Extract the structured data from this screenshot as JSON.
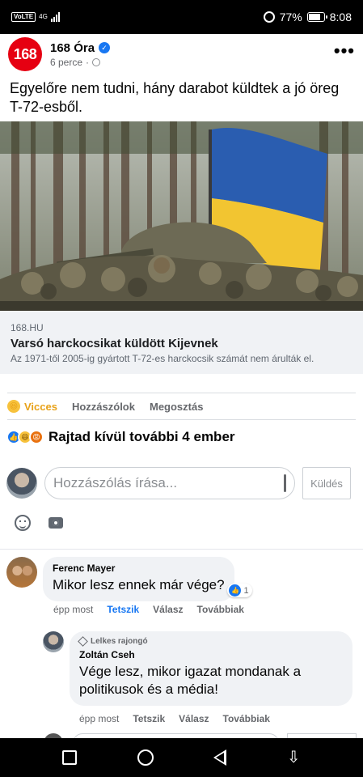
{
  "status_bar": {
    "volte": "VoLTE",
    "network": "4G",
    "battery_percent": "77%",
    "battery_level": 0.77,
    "time": "8:08"
  },
  "post": {
    "page_avatar_text": "168",
    "page_name": "168 Óra",
    "time": "6 perce",
    "separator": "·",
    "text": "Egyelőre nem tudni, hány darabot küldtek a jó öreg T-72-esből.",
    "link": {
      "domain": "168.HU",
      "title": "Varsó harckocsikat küldött Kijevnek",
      "description": "Az 1971-től 2005-ig gyártott T-72-es harckocsik számát nem árulták el."
    },
    "actions": {
      "reaction": "Vicces",
      "comment": "Hozzászólok",
      "share": "Megosztás"
    },
    "reactions_summary": "Rajtad kívül további 4 ember"
  },
  "composer": {
    "placeholder": "Hozzászólás írása...",
    "send_label": "Küldés"
  },
  "comments": [
    {
      "author": "Ferenc Mayer",
      "text": "Mikor lesz ennek már vége?",
      "reaction_count": "1",
      "time": "épp most",
      "like": "Tetszik",
      "reply": "Válasz",
      "more": "Továbbiak"
    },
    {
      "badge": "Lelkes rajongó",
      "author": "Zoltán Cseh",
      "text": "Vége lesz, mikor igazat mondanak a politikusok és a média!",
      "time": "épp most",
      "like": "Tetszik",
      "reply": "Válasz",
      "more": "Továbbiak"
    }
  ],
  "colors": {
    "brand_red": "#e60012",
    "facebook_blue": "#1877f2",
    "haha_yellow": "#e8a219"
  }
}
